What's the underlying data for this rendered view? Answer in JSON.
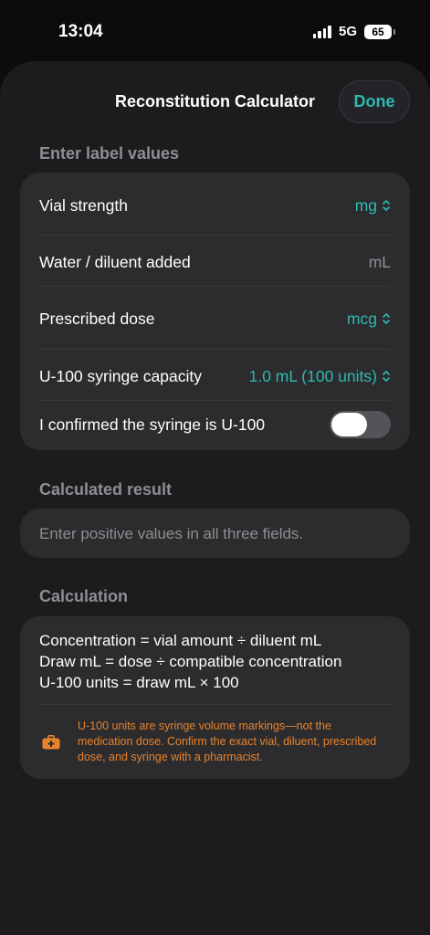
{
  "status_bar": {
    "time": "13:04",
    "network": "5G",
    "battery": "65"
  },
  "header": {
    "title": "Reconstitution Calculator",
    "done_label": "Done"
  },
  "label_values": {
    "section_title": "Enter label values",
    "rows": [
      {
        "label": "Vial strength",
        "value": "mg"
      },
      {
        "label": "Water / diluent added",
        "value": "mL"
      },
      {
        "label": "Prescribed dose",
        "value": "mcg"
      },
      {
        "label": "U-100 syringe capacity",
        "value": "1.0 mL (100 units)"
      }
    ],
    "confirm_label": "I confirmed the syringe is U-100",
    "confirm_on": false
  },
  "result": {
    "section_title": "Calculated result",
    "message": "Enter positive values in all three fields."
  },
  "calculation": {
    "section_title": "Calculation",
    "formulas": [
      "Concentration = vial amount ÷ diluent mL",
      "Draw mL = dose ÷ compatible concentration",
      "U-100 units = draw mL × 100"
    ],
    "warning_icon": "medical-kit-icon",
    "warning": "U-100 units are syringe volume markings—not the medication dose. Confirm the exact vial, diluent, prescribed dose, and syringe with a pharmacist."
  },
  "colors": {
    "accent": "#2fb8b0",
    "warning": "#e8822c",
    "sheet_bg": "#1c1c1e",
    "card_bg": "#2c2c2e",
    "secondary_text": "#8e8e93"
  }
}
